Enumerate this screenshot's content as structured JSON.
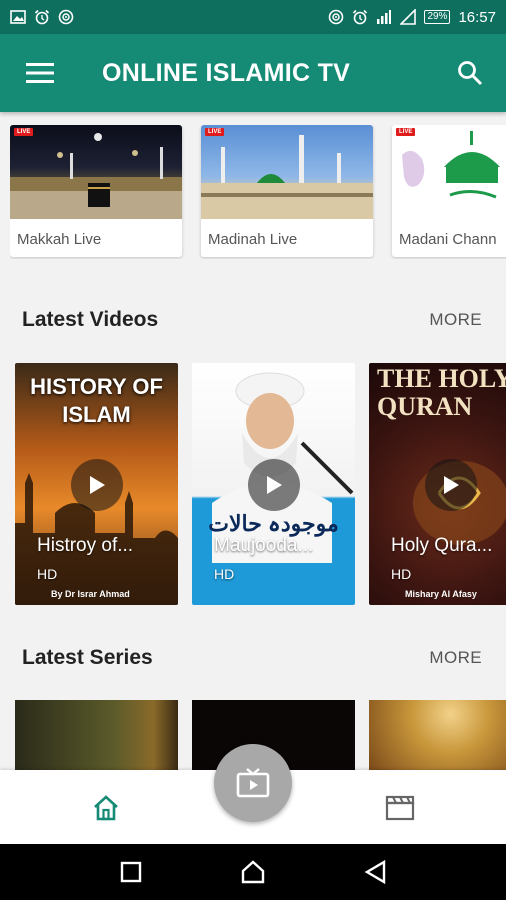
{
  "status_bar": {
    "time": "16:57",
    "battery": "29%",
    "left_icons": [
      "image-icon",
      "alarm-icon",
      "cast-icon"
    ],
    "right_icons": [
      "cast-icon",
      "alarm-icon",
      "signal-icon",
      "wifi-icon",
      "battery-icon"
    ]
  },
  "app_bar": {
    "title": "ONLINE ISLAMIC TV",
    "menu_icon": "menu-icon",
    "search_icon": "search-icon",
    "color": "#158a74"
  },
  "live_channels": [
    {
      "label": "Makkah Live",
      "badge": "LIVE"
    },
    {
      "label": "Madinah Live",
      "badge": "LIVE"
    },
    {
      "label": "Madani Chann",
      "badge": "LIVE"
    }
  ],
  "latest_videos": {
    "title": "Latest Videos",
    "more": "MORE",
    "items": [
      {
        "title": "Histroy of...",
        "quality": "HD",
        "poster_heading": "HISTORY OF ISLAM",
        "credit": "By Dr Israr Ahmad"
      },
      {
        "title": "Maujooda...",
        "quality": "HD",
        "poster_heading": "موجودہ حالات",
        "credit": ""
      },
      {
        "title": "Holy Qura...",
        "quality": "HD",
        "poster_heading": "THE HOLY QURAN",
        "credit": "Mishary Al Afasy"
      }
    ]
  },
  "latest_series": {
    "title": "Latest Series",
    "more": "MORE"
  },
  "bottom_nav": {
    "home_icon": "home-icon",
    "tv_icon": "tv-icon",
    "clapper_icon": "clapperboard-icon"
  },
  "system_nav": [
    "recents-icon",
    "home-circle-icon",
    "back-icon"
  ]
}
